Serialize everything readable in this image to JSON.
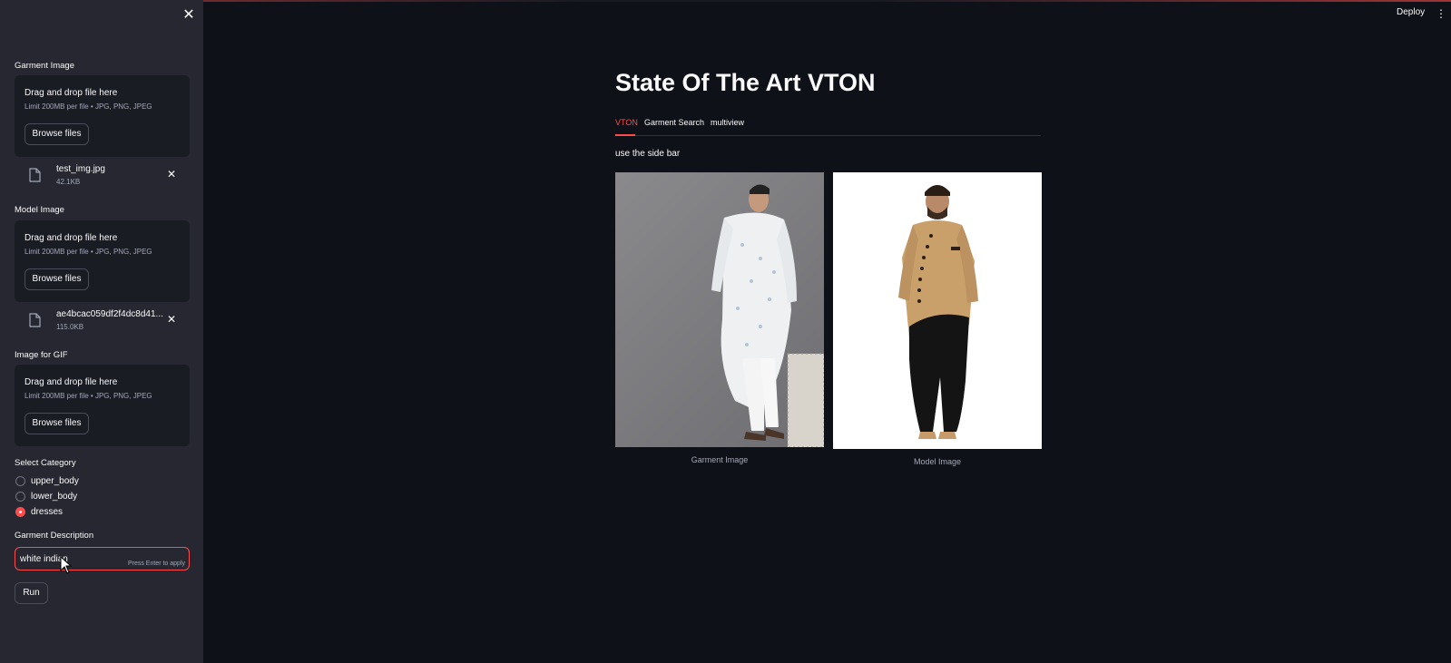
{
  "sidebar": {
    "garment_image": {
      "label": "Garment Image",
      "drop_title": "Drag and drop file here",
      "drop_limit": "Limit 200MB per file • JPG, PNG, JPEG",
      "browse_label": "Browse files",
      "file": {
        "name": "test_img.jpg",
        "size": "42.1KB"
      }
    },
    "model_image": {
      "label": "Model Image",
      "drop_title": "Drag and drop file here",
      "drop_limit": "Limit 200MB per file • JPG, PNG, JPEG",
      "browse_label": "Browse files",
      "file": {
        "name": "ae4bcac059df2f4dc8d41...",
        "size": "115.0KB"
      }
    },
    "gif_image": {
      "label": "Image for GIF",
      "drop_title": "Drag and drop file here",
      "drop_limit": "Limit 200MB per file • JPG, PNG, JPEG",
      "browse_label": "Browse files"
    },
    "category": {
      "label": "Select Category",
      "options": [
        "upper_body",
        "lower_body",
        "dresses"
      ],
      "selected": "dresses"
    },
    "description": {
      "label": "Garment Description",
      "value": "white indian",
      "hint": "Press Enter to apply"
    },
    "run_label": "Run"
  },
  "header": {
    "deploy_label": "Deploy",
    "menu_icon": "⋮"
  },
  "main": {
    "title": "State Of The Art VTON",
    "tabs": [
      "VTON",
      "Garment Search",
      "multiview"
    ],
    "active_tab": "VTON",
    "hint": "use the side bar",
    "images": [
      {
        "caption": "Garment Image"
      },
      {
        "caption": "Model Image"
      }
    ]
  },
  "colors": {
    "accent": "#ff4b4b",
    "background": "#0e1117",
    "sidebar": "#262730"
  }
}
